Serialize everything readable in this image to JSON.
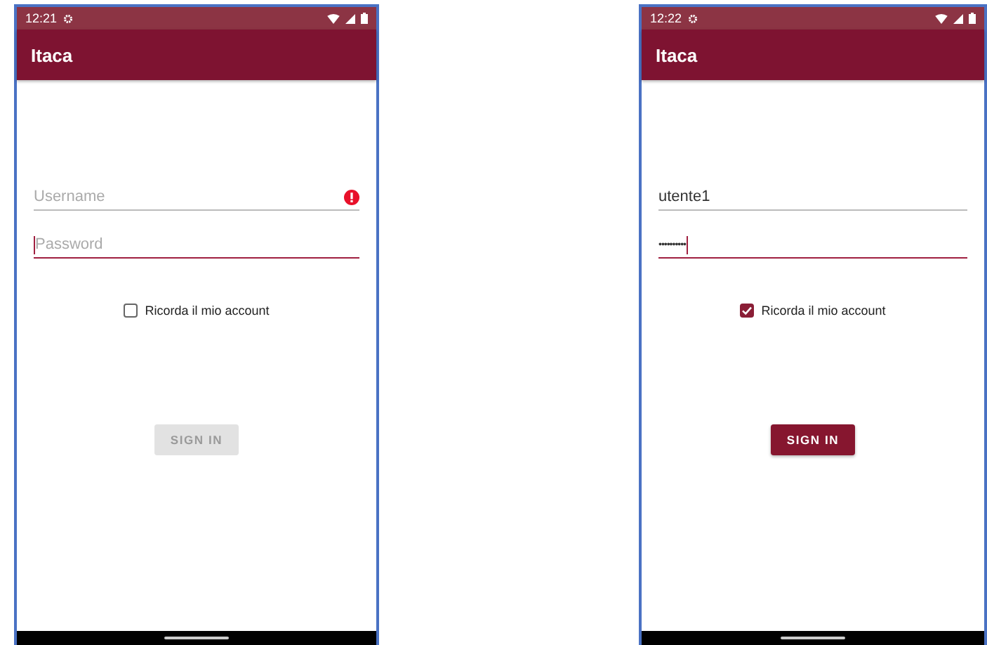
{
  "screens": [
    {
      "status_time": "12:21",
      "app_title": "Itaca",
      "username": {
        "placeholder": "Username",
        "error": true,
        "focused": false
      },
      "password": {
        "placeholder": "Password",
        "focused": true
      },
      "remember": {
        "label": "Ricorda il mio account",
        "checked": false
      },
      "sign_in": {
        "label": "SIGN IN",
        "disabled": true
      }
    },
    {
      "status_time": "12:22",
      "app_title": "Itaca",
      "username": {
        "value": "utente1",
        "error": false,
        "focused": false
      },
      "password": {
        "value": "••••••••••",
        "focused": true
      },
      "remember": {
        "label": "Ricorda il mio account",
        "checked": true
      },
      "sign_in": {
        "label": "SIGN IN",
        "disabled": false
      }
    }
  ]
}
